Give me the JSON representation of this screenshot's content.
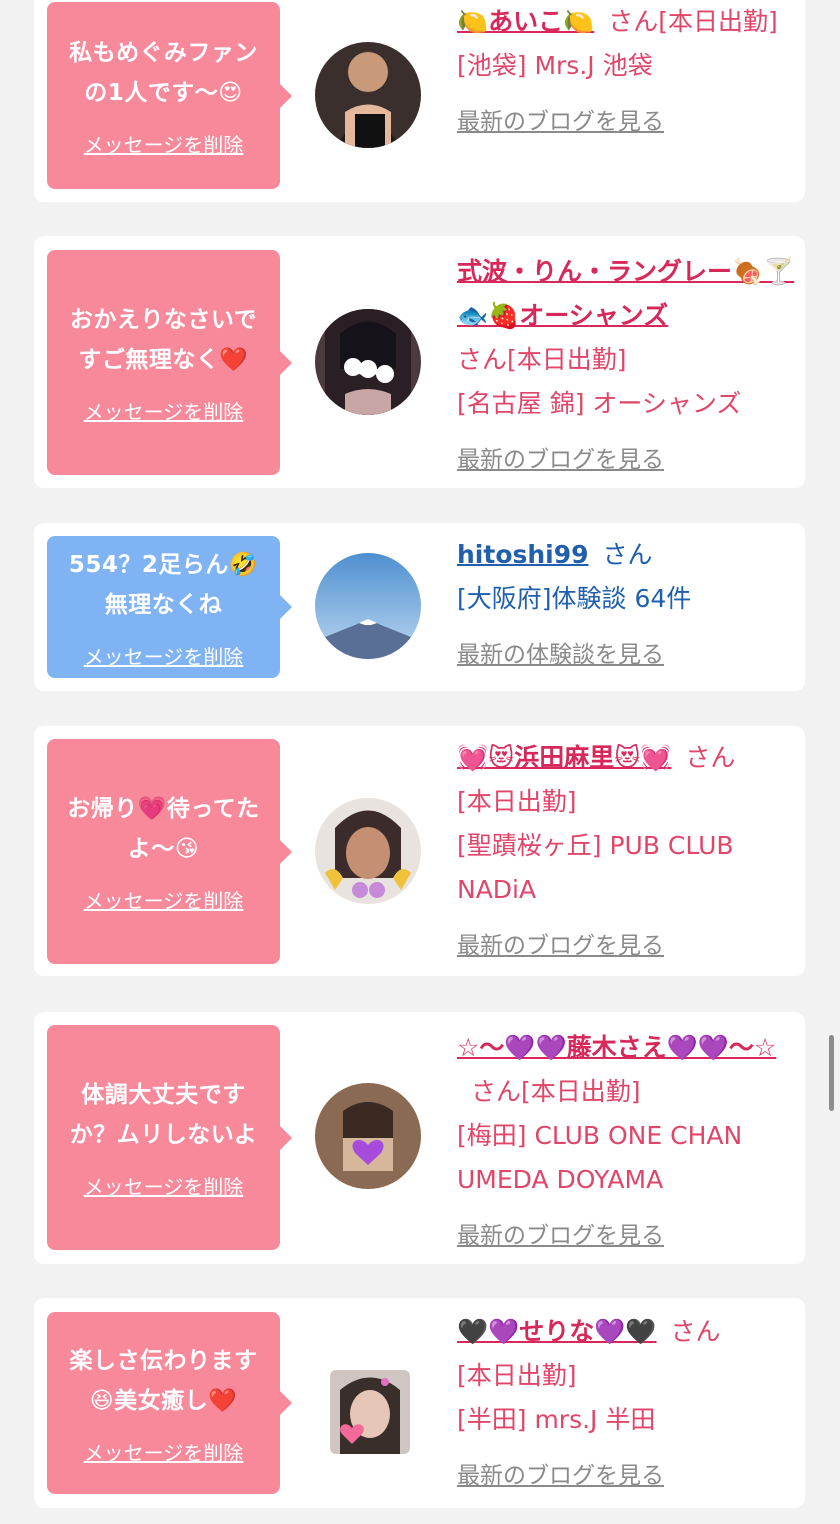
{
  "messages": [
    {
      "bubble_text": "私もめぐみファン\nの1人です〜😍",
      "delete_label": "メッセージを削除",
      "name": "🍋あいこ🍋",
      "san": "さん",
      "status": "[本日出勤]",
      "location": "[池袋] Mrs.J 池袋",
      "blog_label": "最新のブログを見る"
    },
    {
      "bubble_text": "おかえりなさいで\nすご無理なく❤️",
      "delete_label": "メッセージを削除",
      "name": "式波・りん・ラングレー🍖🍸🐟🍓オーシャンズ",
      "san": "さん",
      "status": "[本日出勤]",
      "location": "[名古屋 錦] オーシャンズ",
      "blog_label": "最新のブログを見る"
    },
    {
      "bubble_text": "554？2足らん🤣\n無理なくね",
      "delete_label": "メッセージを削除",
      "name": "hitoshi99",
      "san": "さん",
      "location": "[大阪府]体験談 64件",
      "blog_label": "最新の体験談を見る"
    },
    {
      "bubble_text": "お帰り💗待ってた\nよ〜😘",
      "delete_label": "メッセージを削除",
      "name": "💓😻浜田麻里😻💓",
      "san": "さん",
      "status": "[本日出勤]",
      "location": "[聖蹟桜ヶ丘] PUB CLUB NADiA",
      "blog_label": "最新のブログを見る"
    },
    {
      "bubble_text": "体調大丈夫です\nか？ムリしないよ",
      "delete_label": "メッセージを削除",
      "name": "☆〜💜💜藤木さえ💜💜〜☆",
      "san": "さん",
      "status": "[本日出勤]",
      "location": "[梅田] CLUB ONE CHAN UMEDA DOYAMA",
      "blog_label": "最新のブログを見る"
    },
    {
      "bubble_text": "楽しさ伝わります\n😆美女癒し❤️",
      "delete_label": "メッセージを削除",
      "name": "🖤💜せりな💜🖤",
      "san": "さん",
      "status": "[本日出勤]",
      "location": "[半田] mrs.J 半田",
      "blog_label": "最新のブログを見る"
    }
  ],
  "colors": {
    "pink_bubble": "#f7899a",
    "blue_bubble": "#7fb3f3",
    "name_pink": "#d8285a",
    "name_blue": "#1f5fae",
    "link_gray": "#8a8a8a"
  }
}
